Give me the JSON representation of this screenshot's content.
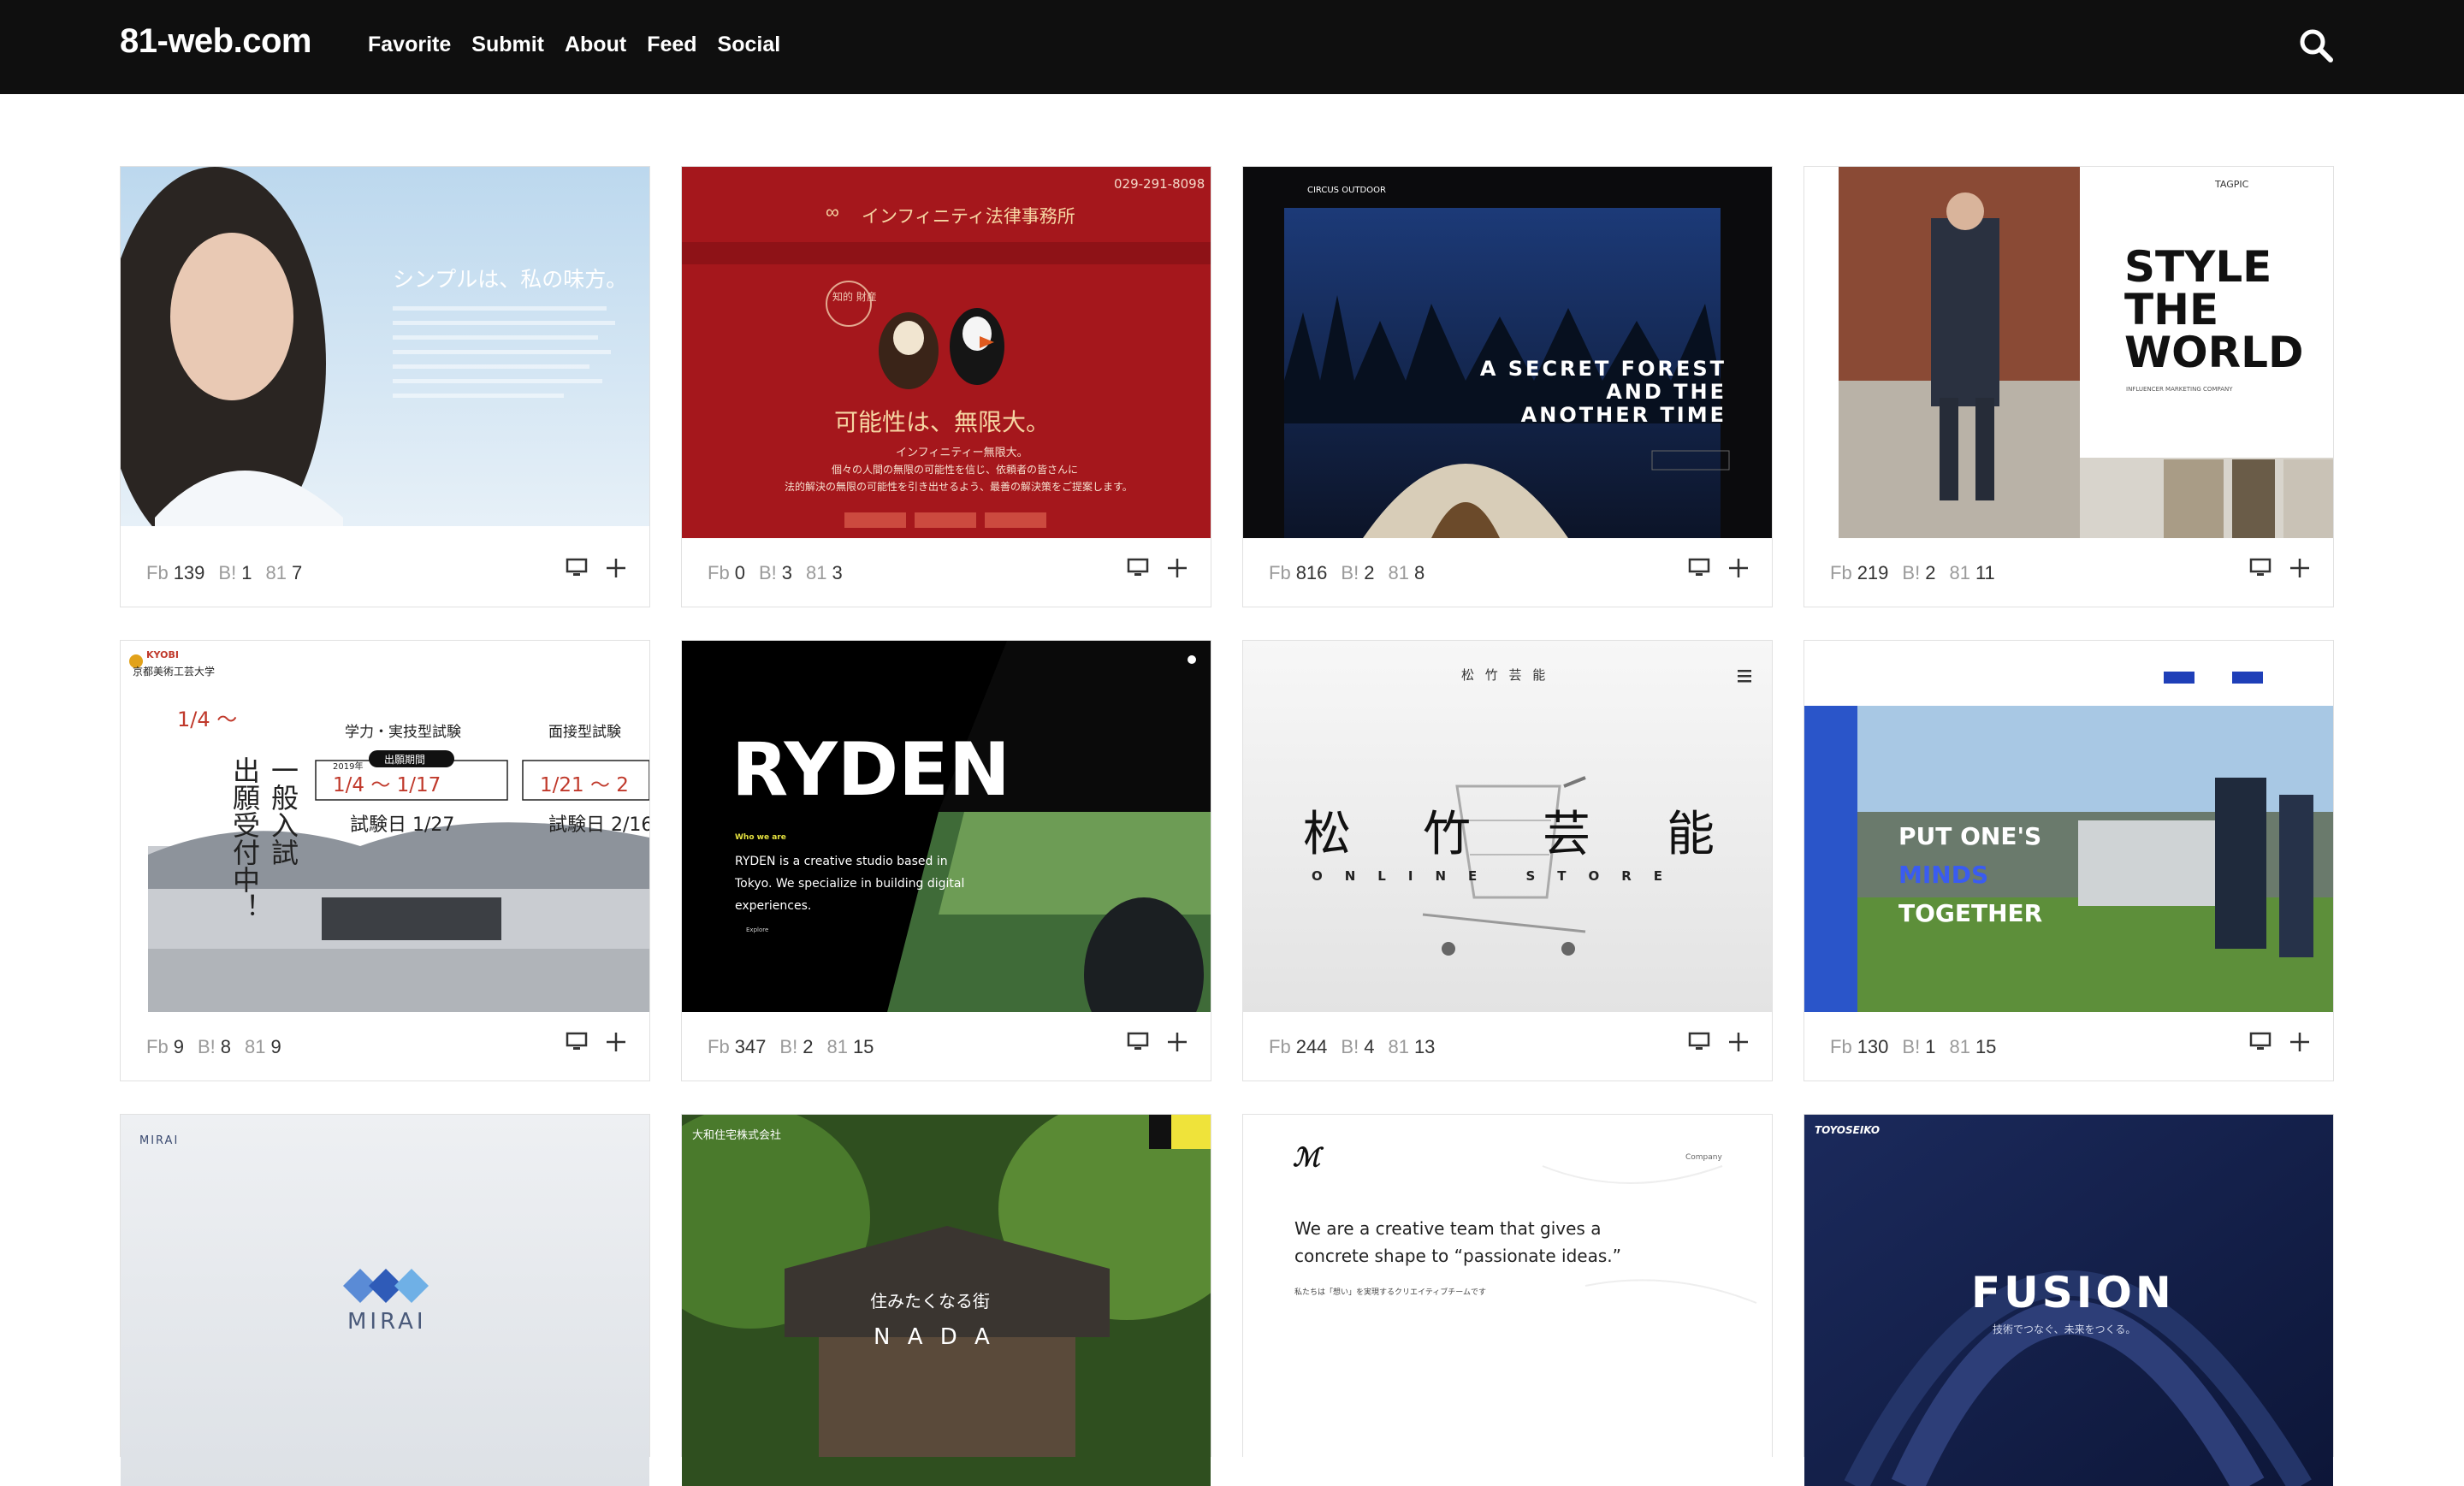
{
  "site": {
    "logo": "81-web.com",
    "nav": [
      "Favorite",
      "Submit",
      "About",
      "Feed",
      "Social"
    ]
  },
  "stat_labels": {
    "fb": "Fb",
    "b": "B!",
    "81": "81"
  },
  "cards": [
    {
      "stats": [
        "139",
        "1",
        "7"
      ],
      "thumb_text": {
        "tagline": "シンプルは、私の味方。"
      }
    },
    {
      "stats": [
        "0",
        "3",
        "3"
      ],
      "thumb_text": {
        "phone": "029-291-8098",
        "name": "インフィニティ法律事務所",
        "tagline": "可能性は、無限大。",
        "lead": "インフィニティー無限大。",
        "body1": "個々の人間の無限の可能性を信じ、依頼者の皆さんに",
        "body2": "法的解決の無限の可能性を引き出せるよう、最善の解決策をご提案します。",
        "badge": "知的 財産"
      }
    },
    {
      "stats": [
        "816",
        "2",
        "8"
      ],
      "thumb_text": {
        "line1": "A SECRET FOREST",
        "line2": "AND THE",
        "line3": "ANOTHER TIME",
        "brand": "CIRCUS OUTDOOR"
      }
    },
    {
      "stats": [
        "219",
        "2",
        "11"
      ],
      "thumb_text": {
        "brand": "TAGPIC",
        "line1": "STYLE",
        "line2": "THE",
        "line3": "WORLD",
        "sub": "INFLUENCER MARKETING COMPANY"
      }
    },
    {
      "stats": [
        "9",
        "8",
        "9"
      ],
      "thumb_text": {
        "school": "京都美術工芸大学",
        "brand": "KYOBI",
        "label1": "学力・実技型試験",
        "label2": "面接型試験",
        "period": "出願期間",
        "range1": "1/4 〜 1/17",
        "exam1": "試験日 1/27",
        "range2": "1/21 〜 2",
        "exam2": "試験日 2/16",
        "vertical1": "出願受付中！",
        "vertical2": "一般入試",
        "head_date": "1/4 〜",
        "year": "2019年"
      }
    },
    {
      "stats": [
        "347",
        "2",
        "15"
      ],
      "thumb_text": {
        "title": "RYDEN",
        "who": "Who we are",
        "line1": "RYDEN is a creative studio based in",
        "line2": "Tokyo. We specialize in building digital",
        "line3": "experiences.",
        "explore": "Explore"
      }
    },
    {
      "stats": [
        "244",
        "4",
        "13"
      ],
      "thumb_text": {
        "c1": "松",
        "c2": "竹",
        "c3": "芸",
        "c4": "能",
        "sub": "ONLINE STORE",
        "head": "松 竹 芸 能"
      }
    },
    {
      "stats": [
        "130",
        "1",
        "15"
      ],
      "thumb_text": {
        "line1": "PUT ONE'S",
        "line2": "MINDS",
        "line3": "TOGETHER"
      }
    },
    {
      "stats": [],
      "thumb_text": {
        "brand": "MIRAI",
        "word": "MIRAI"
      }
    },
    {
      "stats": [],
      "thumb_text": {
        "brand": "大和住宅株式会社",
        "line1": "住みたくなる街",
        "line2": "N A D A"
      }
    },
    {
      "stats": [],
      "thumb_text": {
        "line1": "We are a creative team that gives a",
        "line2": "concrete shape to “passionate ideas.”",
        "jp": "私たちは「想い」を実現するクリエイティブチームです",
        "company": "Company"
      }
    },
    {
      "stats": [],
      "thumb_text": {
        "brand": "TOYOSEIKO",
        "title": "FUSION",
        "sub": "技術でつなぐ、未来をつくる。"
      }
    }
  ]
}
